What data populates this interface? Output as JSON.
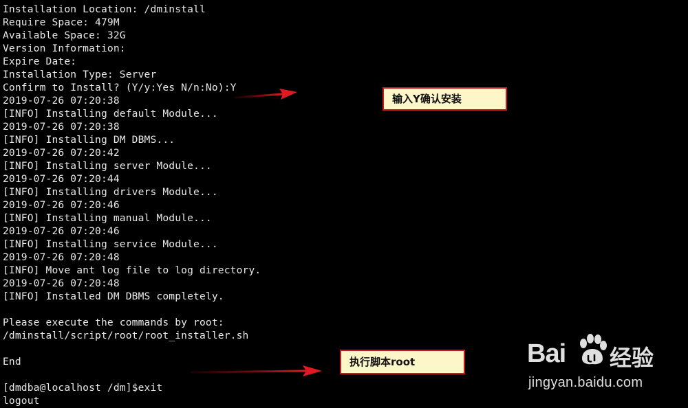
{
  "terminal": {
    "lines": [
      "Installation Location: /dminstall",
      "Require Space: 479M",
      "Available Space: 32G",
      "Version Information:",
      "Expire Date:",
      "Installation Type: Server",
      "Confirm to Install? (Y/y:Yes N/n:No):Y",
      "2019-07-26 07:20:38",
      "[INFO] Installing default Module...",
      "2019-07-26 07:20:38",
      "[INFO] Installing DM DBMS...",
      "2019-07-26 07:20:42",
      "[INFO] Installing server Module...",
      "2019-07-26 07:20:44",
      "[INFO] Installing drivers Module...",
      "2019-07-26 07:20:46",
      "[INFO] Installing manual Module...",
      "2019-07-26 07:20:46",
      "[INFO] Installing service Module...",
      "2019-07-26 07:20:48",
      "[INFO] Move ant log file to log directory.",
      "2019-07-26 07:20:48",
      "[INFO] Installed DM DBMS completely.",
      "",
      "Please execute the commands by root:",
      "/dminstall/script/root/root_installer.sh",
      "",
      "End",
      "",
      "[dmdba@localhost /dm]$exit",
      "logout"
    ]
  },
  "annotations": {
    "confirm_callout": "输入Y确认安装",
    "root_callout": "执行脚本root"
  },
  "watermark": {
    "brand": "Bai",
    "brand_suffix": "经验",
    "url": "jingyan.baidu.com"
  },
  "colors": {
    "terminal_bg": "#000000",
    "terminal_text": "#e8e8e8",
    "callout_bg": "#fdf6c9",
    "callout_border": "#c8191e",
    "arrow": "#d0161c"
  }
}
